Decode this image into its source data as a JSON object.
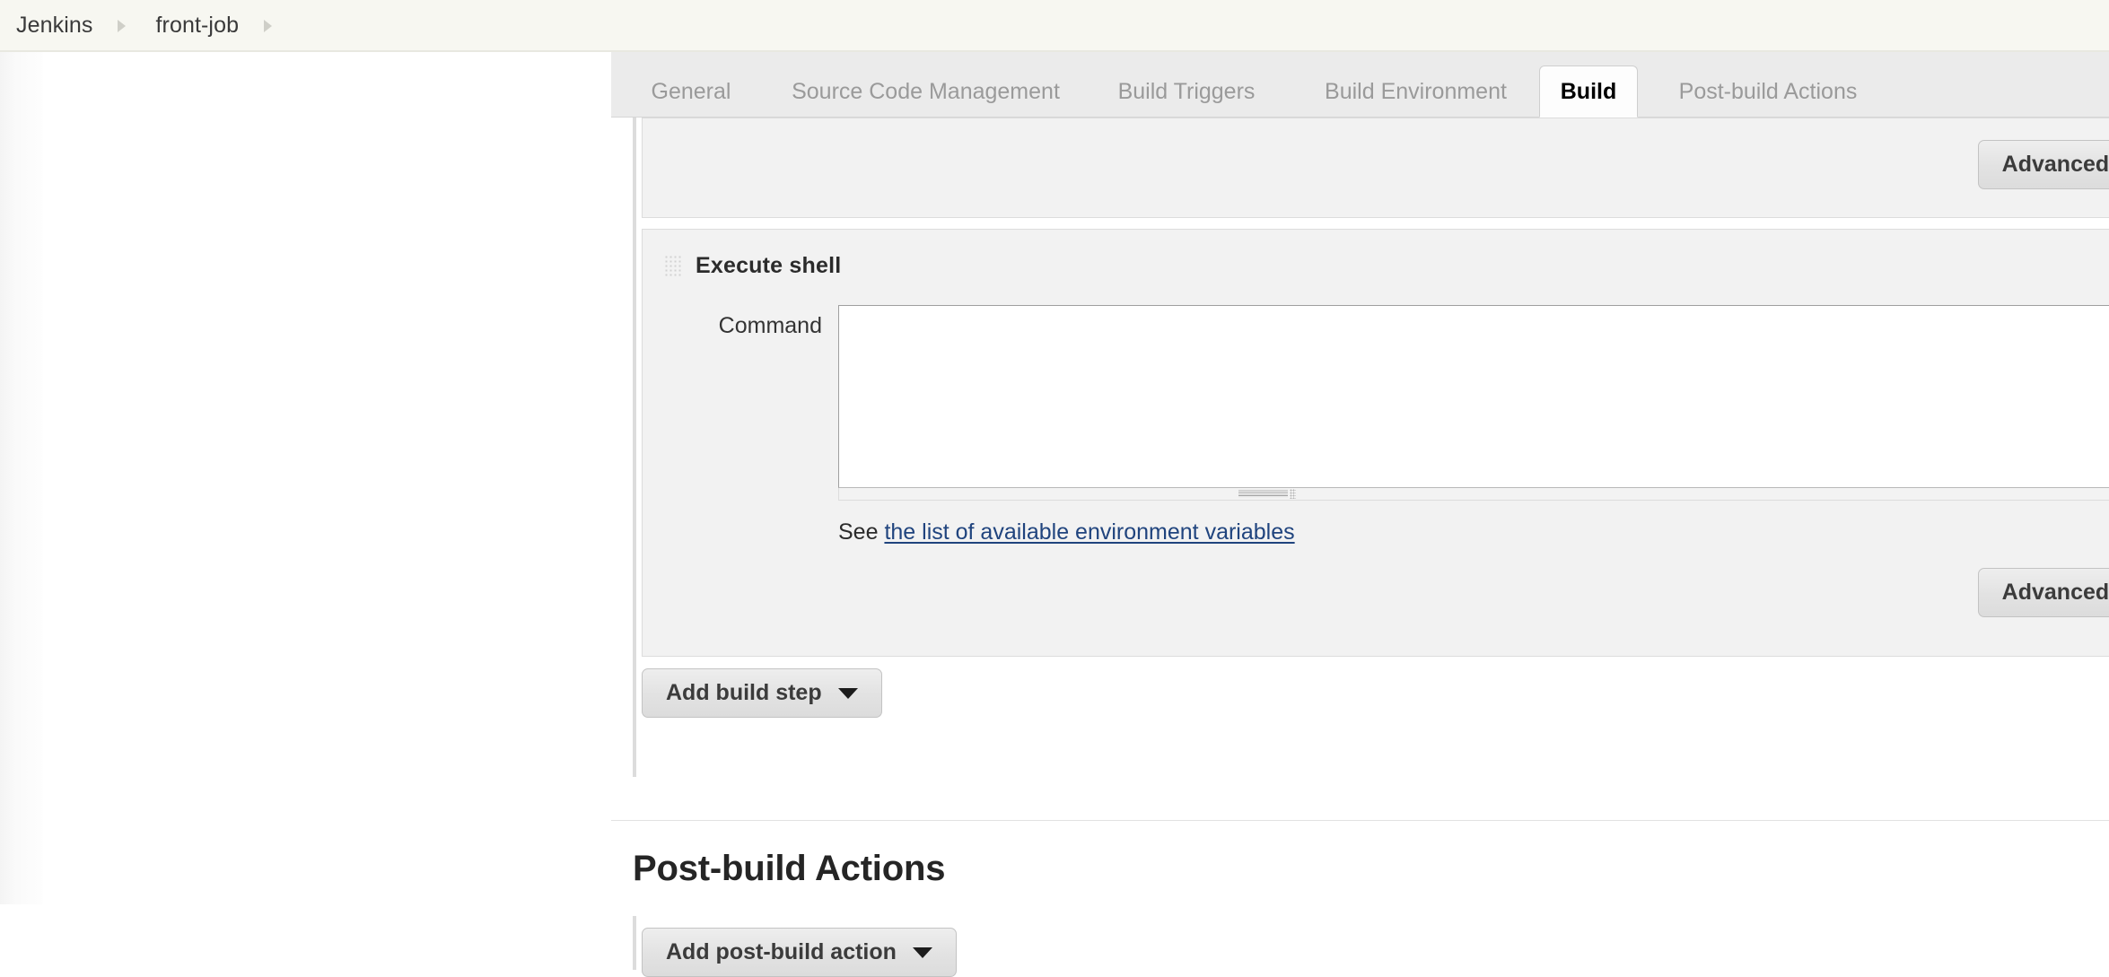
{
  "breadcrumb": {
    "items": [
      {
        "label": "Jenkins"
      },
      {
        "label": "front-job"
      }
    ],
    "separator_icon": "chevron-right-icon"
  },
  "tabs": [
    {
      "label": "General",
      "active": false
    },
    {
      "label": "Source Code Management",
      "active": false
    },
    {
      "label": "Build Triggers",
      "active": false
    },
    {
      "label": "Build Environment",
      "active": false
    },
    {
      "label": "Build",
      "active": true
    },
    {
      "label": "Post-build Actions",
      "active": false
    }
  ],
  "build_section": {
    "previous_step": {
      "advanced_label": "Advanced..."
    },
    "execute_shell": {
      "title": "Execute shell",
      "grip_icon": "drag-handle-icon",
      "command_label": "Command",
      "command_value": "",
      "command_placeholder": "",
      "help_prefix": "See ",
      "help_link": "the list of available environment variables",
      "advanced_label": "Advanced..."
    },
    "add_build_step_label": "Add build step",
    "caret_icon": "caret-down-icon"
  },
  "post_build_section": {
    "heading": "Post-build Actions",
    "add_post_build_action_label": "Add post-build action",
    "caret_icon": "caret-down-icon"
  },
  "colors": {
    "breadcrumb_bg": "#f7f7f1",
    "tabbar_bg": "#ebebeb",
    "panel_bg": "#f2f2f2",
    "link": "#20447e",
    "active_tab_text": "#000000",
    "inactive_tab_text": "#9a9a9a"
  }
}
